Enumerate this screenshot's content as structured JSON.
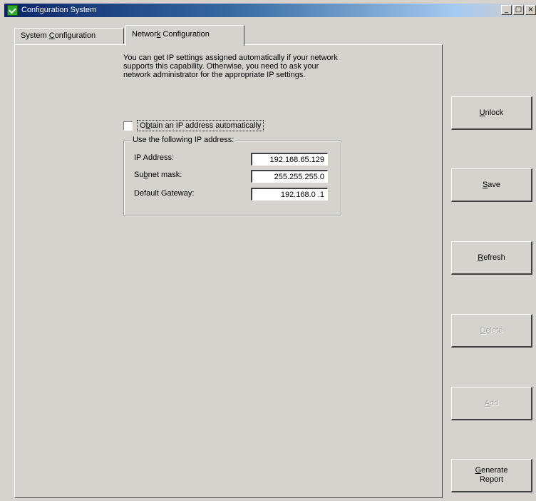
{
  "window": {
    "title": "Configuration System",
    "controls": {
      "minimize": "_",
      "maximize": "□",
      "close": "×"
    }
  },
  "tabs": [
    {
      "prefix": "System ",
      "accel": "C",
      "suffix": "onfiguration",
      "active": false
    },
    {
      "prefix": "Networ",
      "accel": "k",
      "suffix": " Configuration",
      "active": true
    }
  ],
  "network": {
    "intro": "You can get IP settings assigned automatically if your network supports this capability. Otherwise, you need to ask your network administrator for the appropriate IP settings.",
    "auto_checkbox": {
      "prefix": "O",
      "accel": "b",
      "suffix": "tain an IP address automatically",
      "checked": false
    },
    "group_title": "Use the following IP address:",
    "fields": [
      {
        "label_prefix": "IP Address:",
        "label_accel": "",
        "label_suffix": "",
        "value": "192.168.65.129"
      },
      {
        "label_prefix": "Su",
        "label_accel": "b",
        "label_suffix": "net mask:",
        "value": "255.255.255.0"
      },
      {
        "label_prefix": "Default Gateway:",
        "label_accel": "",
        "label_suffix": "",
        "value": "192.168.0 .1"
      }
    ]
  },
  "buttons": [
    {
      "accel": "U",
      "rest": "nlock",
      "enabled": true
    },
    {
      "accel": "S",
      "rest": "ave",
      "enabled": true
    },
    {
      "accel": "R",
      "rest": "efresh",
      "enabled": true
    },
    {
      "accel": "D",
      "rest": "elete",
      "enabled": false
    },
    {
      "accel": "A",
      "rest": "dd",
      "enabled": false
    },
    {
      "accel": "G",
      "rest": "enerate\nReport",
      "enabled": true
    }
  ],
  "colors": {
    "face": "#d6d3ce",
    "title_bar_start": "#0a246a",
    "title_bar_end": "#a6caf0",
    "disabled_text": "#a8a6a2"
  }
}
